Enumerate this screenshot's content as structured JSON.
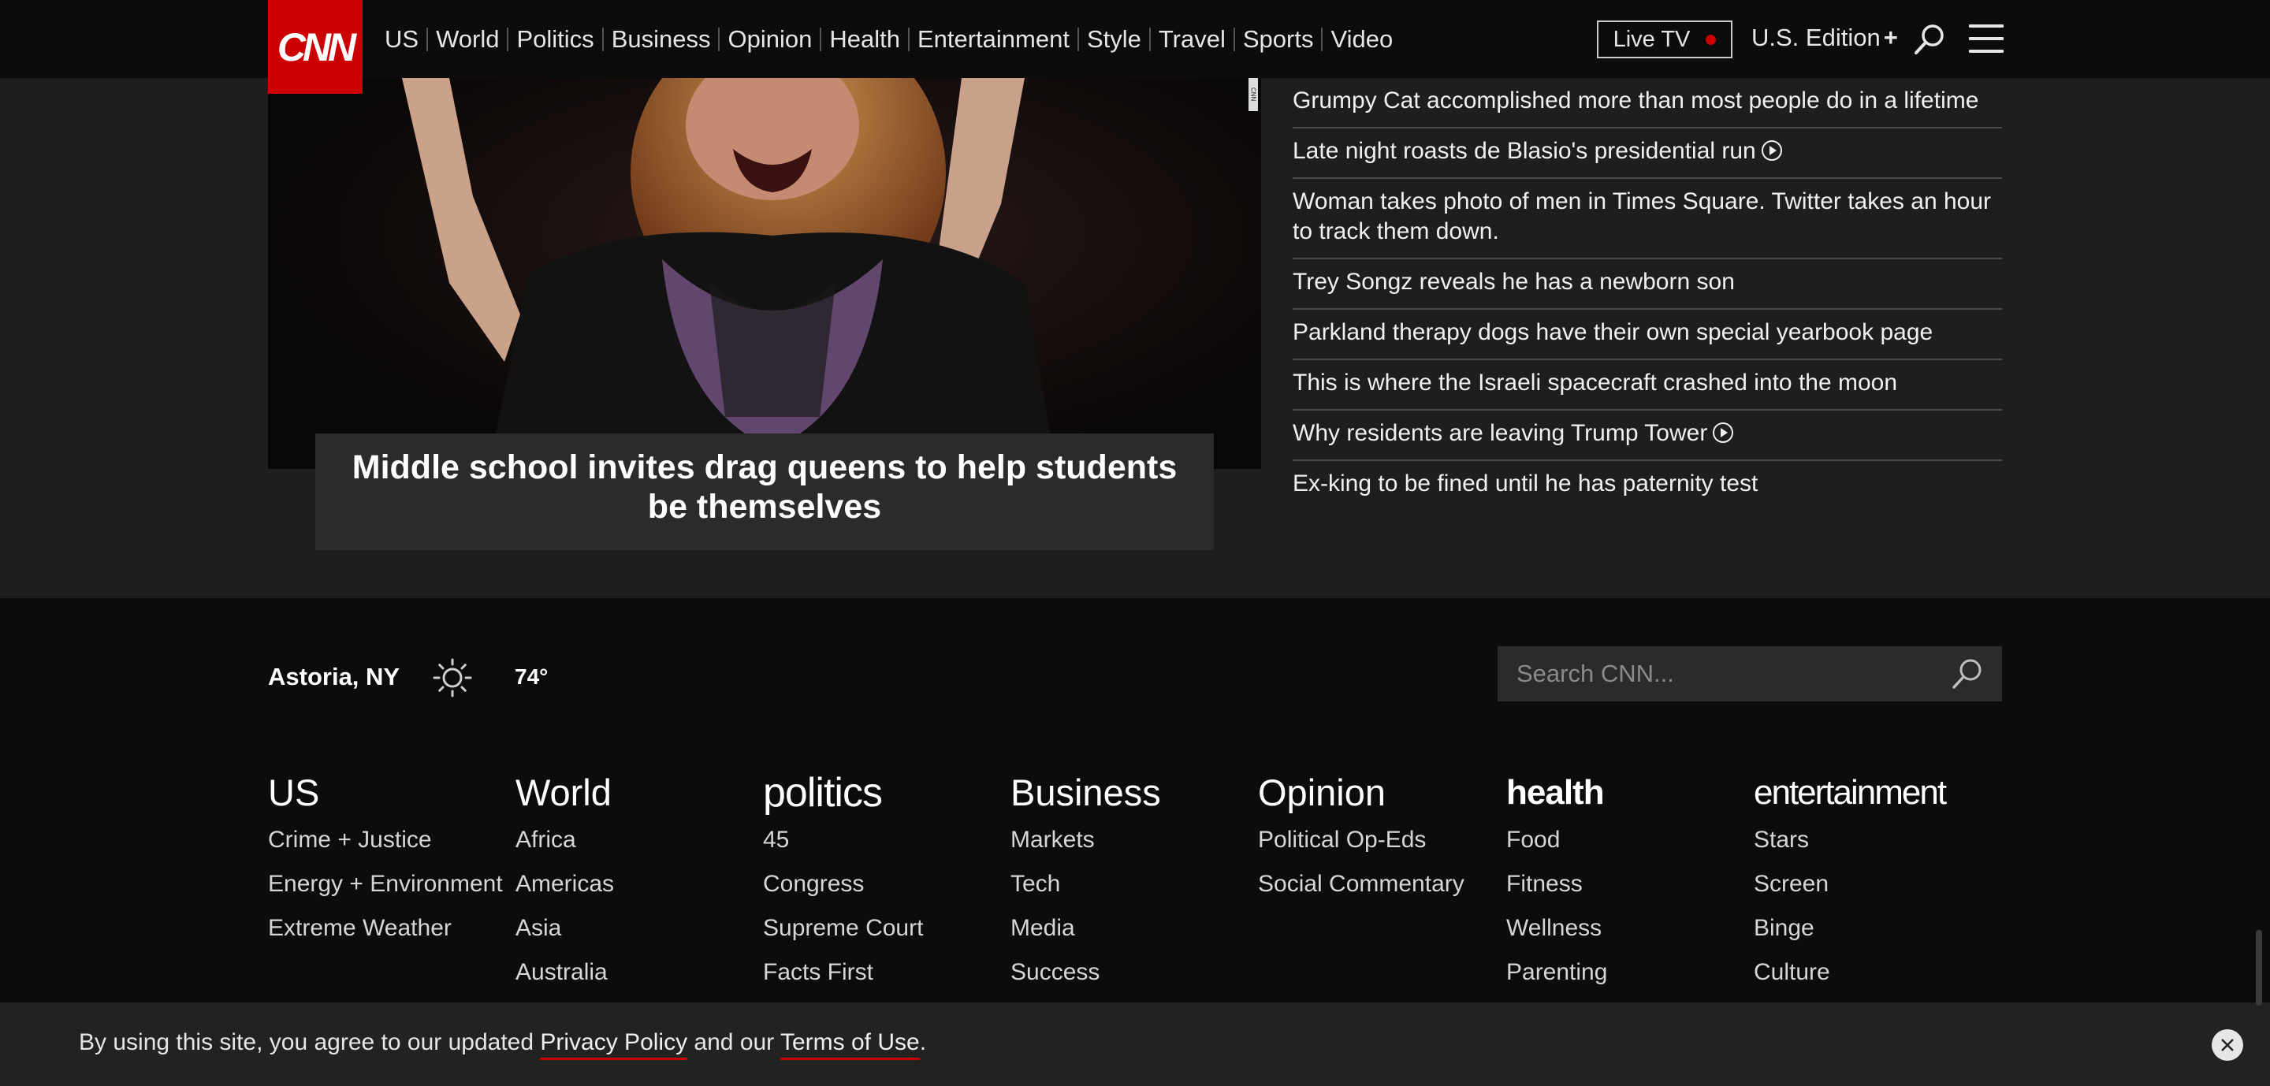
{
  "header": {
    "logo": "CNN",
    "nav": [
      "US",
      "World",
      "Politics",
      "Business",
      "Opinion",
      "Health",
      "Entertainment",
      "Style",
      "Travel",
      "Sports",
      "Video"
    ],
    "live_tv": "Live TV",
    "edition": "U.S. Edition",
    "edition_plus": "+",
    "colors": {
      "brand": "#cc0000",
      "background": "#0c0c0c"
    }
  },
  "hero": {
    "caption": "Middle school invites drag queens to help students be themselves",
    "photo_credit": "CNN"
  },
  "headlines": [
    {
      "text": "Grumpy Cat accomplished more than most people do in a lifetime",
      "video": false
    },
    {
      "text": "Late night roasts de Blasio's presidential run",
      "video": true
    },
    {
      "text": "Woman takes photo of men in Times Square. Twitter takes an hour to track them down.",
      "video": false
    },
    {
      "text": "Trey Songz reveals he has a newborn son",
      "video": false
    },
    {
      "text": "Parkland therapy dogs have their own special yearbook page",
      "video": false
    },
    {
      "text": "This is where the Israeli spacecraft crashed into the moon",
      "video": false
    },
    {
      "text": "Why residents are leaving Trump Tower",
      "video": true
    },
    {
      "text": "Ex-king to be fined until he has paternity test",
      "video": false
    }
  ],
  "weather": {
    "location": "Astoria, NY",
    "icon": "sun-icon",
    "temp": "74°"
  },
  "footer_search": {
    "placeholder": "Search CNN..."
  },
  "footer_columns": [
    {
      "title": "US",
      "style": "plain",
      "items": [
        "Crime + Justice",
        "Energy + Environment",
        "Extreme Weather"
      ]
    },
    {
      "title": "World",
      "style": "plain",
      "items": [
        "Africa",
        "Americas",
        "Asia",
        "Australia"
      ]
    },
    {
      "title": "politics",
      "style": "politics",
      "items": [
        "45",
        "Congress",
        "Supreme Court",
        "Facts First"
      ]
    },
    {
      "title": "Business",
      "style": "plain",
      "items": [
        "Markets",
        "Tech",
        "Media",
        "Success"
      ]
    },
    {
      "title": "Opinion",
      "style": "plain",
      "items": [
        "Political Op-Eds",
        "Social Commentary"
      ]
    },
    {
      "title": "health",
      "style": "health",
      "items": [
        "Food",
        "Fitness",
        "Wellness",
        "Parenting"
      ]
    },
    {
      "title": "entertainment",
      "style": "ent",
      "items": [
        "Stars",
        "Screen",
        "Binge",
        "Culture"
      ]
    }
  ],
  "cookie": {
    "prefix": "By using this site, you agree to our updated ",
    "privacy": "Privacy Policy",
    "middle": " and our ",
    "terms": "Terms of Use",
    "suffix": "."
  }
}
